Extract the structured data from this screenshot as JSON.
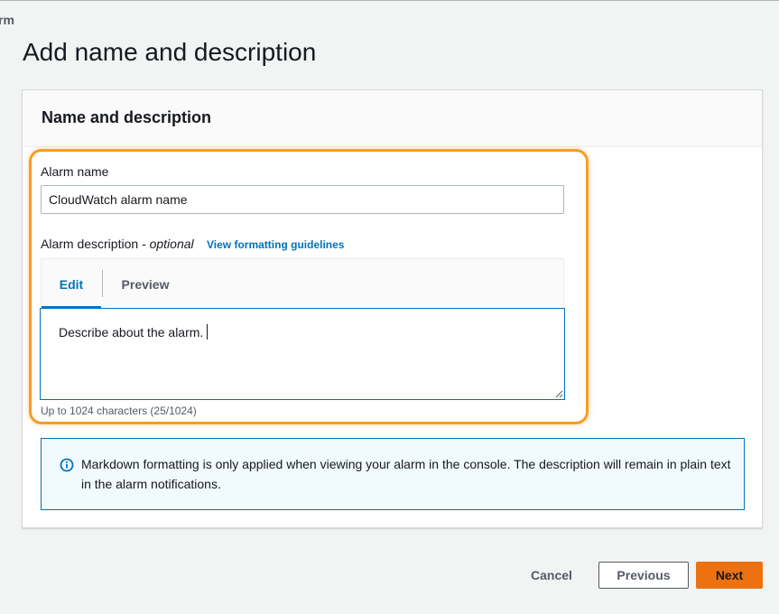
{
  "breadcrumb": {
    "partial_text": "rm"
  },
  "page": {
    "title": "Add name and description"
  },
  "panel": {
    "title": "Name and description",
    "alarm_name": {
      "label": "Alarm name",
      "value": "CloudWatch alarm name"
    },
    "alarm_description": {
      "label": "Alarm description",
      "optional_text": "- optional",
      "guidelines_link": "View formatting guidelines",
      "tabs": [
        {
          "label": "Edit",
          "selected": true
        },
        {
          "label": "Preview",
          "selected": false
        }
      ],
      "value": "Describe about the alarm.",
      "hint": "Up to 1024 characters (25/1024)"
    },
    "info": {
      "icon": "info-icon",
      "text": "Markdown formatting is only applied when viewing your alarm in the console. The description will remain in plain text in the alarm notifications."
    }
  },
  "footer": {
    "cancel_label": "Cancel",
    "previous_label": "Previous",
    "next_label": "Next"
  },
  "colors": {
    "accent_blue": "#0073bb",
    "primary_orange": "#ec7211",
    "highlight_orange": "#f89c25",
    "info_background": "#f1faff"
  }
}
